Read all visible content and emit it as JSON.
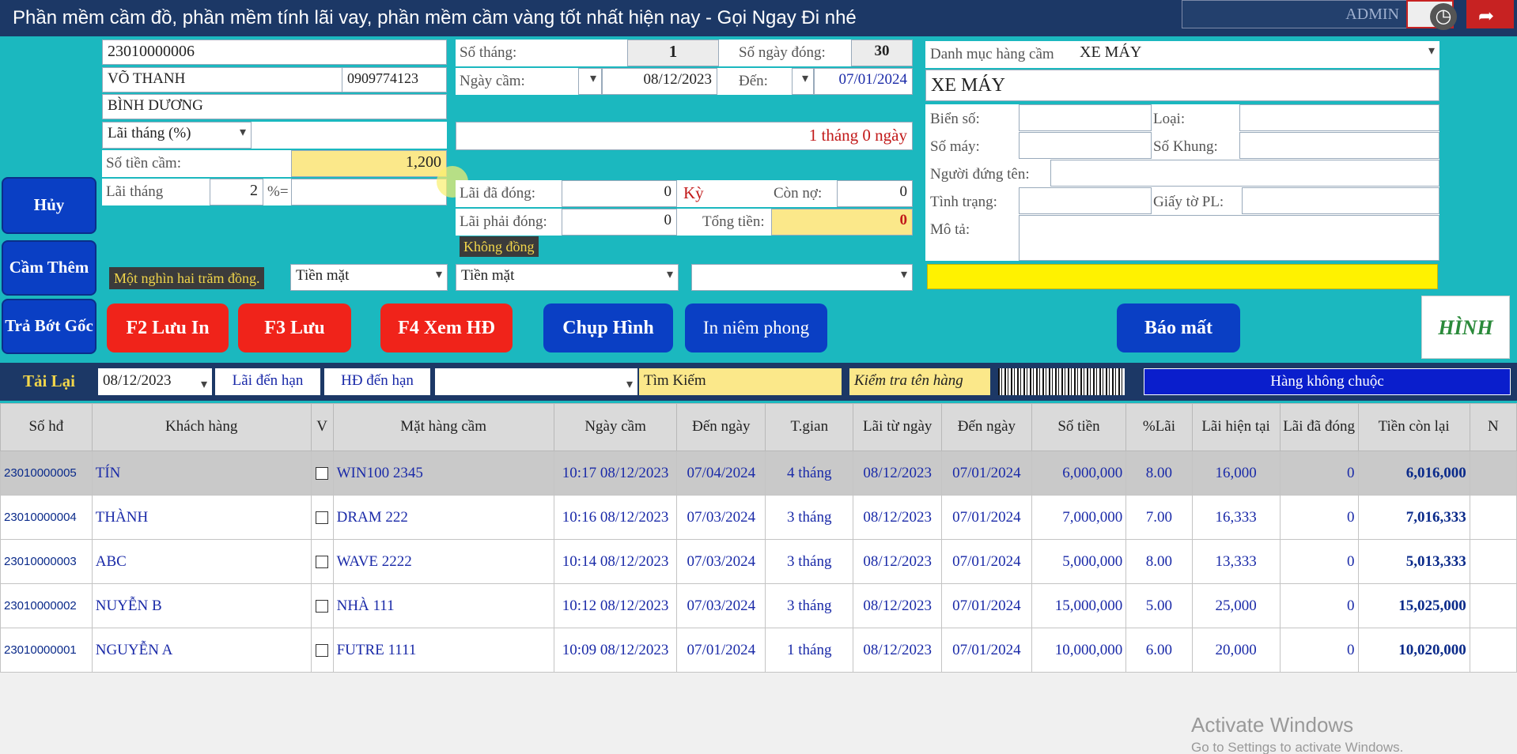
{
  "window": {
    "title": "Phần mềm cầm đồ, phần mềm tính lãi vay, phần mềm cầm vàng tốt nhất hiện nay - Gọi Ngay Đi nhé",
    "user": "ADMIN",
    "clock_icon": "clock-icon",
    "share_icon": "share-icon"
  },
  "customer": {
    "contract_no": "23010000006",
    "name": "VÕ THANH",
    "phone": "0909774123",
    "address": "BÌNH DƯƠNG",
    "interest_type": "Lãi tháng (%)",
    "amount_label": "Số tiền cầm:",
    "amount": "1,200",
    "interest_label": "Lãi tháng",
    "interest_rate": "2",
    "percent_eq": "%=",
    "amount_words": "Một nghìn hai trăm đồng.",
    "payment_method": "Tiền mặt"
  },
  "period": {
    "months_label": "Số tháng:",
    "months": "1",
    "days_paid_label": "Số ngày đóng:",
    "days_paid": "30",
    "pawn_date_label": "Ngày cầm:",
    "pawn_date": "08/12/2023",
    "to_label": "Đến:",
    "to_date": "07/01/2024",
    "duration": "1  tháng  0   ngày",
    "paid_interest_label": "Lãi đã đóng:",
    "paid_interest": "0",
    "period_label": "Kỳ",
    "remaining_label": "Còn nợ:",
    "remaining": "0",
    "due_interest_label": "Lãi phải đóng:",
    "due_interest": "0",
    "total_label": "Tổng tiền:",
    "total": "0",
    "no_money": "Không đồng",
    "payment_method": "Tiền mặt",
    "extra_select": ""
  },
  "item": {
    "category_label": "Danh mục hàng cầm",
    "category": "XE MÁY",
    "name": "XE MÁY",
    "plate_label": "Biển số:",
    "type_label": "Loại:",
    "engine_label": "Số máy:",
    "frame_label": "Số Khung:",
    "owner_label": "Người đứng tên:",
    "condition_label": "Tình trạng:",
    "docs_label": "Giấy tờ PL:",
    "desc_label": "Mô tả:"
  },
  "side_buttons": {
    "cancel": "Hủy",
    "add_pawn": "Cầm Thêm",
    "reduce_principal": "Trả Bớt Gốc"
  },
  "action_buttons": {
    "f2": "F2 Lưu In",
    "f3": "F3 Lưu",
    "f4": "F4 Xem HĐ",
    "photo": "Chụp Hình",
    "seal": "In niêm phong",
    "report_lost": "Báo mất",
    "image_logo": "HÌNH ẢNH"
  },
  "search": {
    "reload": "Tải Lại",
    "date": "08/12/2023",
    "due_interest": "Lãi đến hạn",
    "due_contract": "HĐ đến hạn",
    "filter": "",
    "search": "Tìm Kiếm",
    "check_name": "Kiểm tra tên hàng",
    "status": "Hàng không chuộc"
  },
  "table": {
    "headers": [
      "Số hđ",
      "Khách hàng",
      "V",
      "Mặt hàng cầm",
      "Ngày cầm",
      "Đến ngày",
      "T.gian",
      "Lãi từ ngày",
      "Đến ngày",
      "Số tiền",
      "%Lãi",
      "Lãi hiện tại",
      "Lãi đã đóng",
      "Tiền còn lại",
      "N"
    ],
    "rows": [
      [
        "23010000005",
        "TÍN",
        "",
        "WIN100 2345",
        "10:17 08/12/2023",
        "07/04/2024",
        "4 tháng",
        "08/12/2023",
        "07/01/2024",
        "6,000,000",
        "8.00",
        "16,000",
        "0",
        "6,016,000"
      ],
      [
        "23010000004",
        "THÀNH",
        "",
        "DRAM 222",
        "10:16 08/12/2023",
        "07/03/2024",
        "3 tháng",
        "08/12/2023",
        "07/01/2024",
        "7,000,000",
        "7.00",
        "16,333",
        "0",
        "7,016,333"
      ],
      [
        "23010000003",
        "ABC",
        "",
        "WAVE 2222",
        "10:14 08/12/2023",
        "07/03/2024",
        "3 tháng",
        "08/12/2023",
        "07/01/2024",
        "5,000,000",
        "8.00",
        "13,333",
        "0",
        "5,013,333"
      ],
      [
        "23010000002",
        "NUYỄN B",
        "",
        "NHÀ 111",
        "10:12 08/12/2023",
        "07/03/2024",
        "3 tháng",
        "08/12/2023",
        "07/01/2024",
        "15,000,000",
        "5.00",
        "25,000",
        "0",
        "15,025,000"
      ],
      [
        "23010000001",
        "NGUYỄN A",
        "",
        "FUTRE 1111",
        "10:09 08/12/2023",
        "07/01/2024",
        "1 tháng",
        "08/12/2023",
        "07/01/2024",
        "10,000,000",
        "6.00",
        "20,000",
        "0",
        "10,020,000"
      ]
    ]
  },
  "watermark": {
    "line1": "Activate Windows",
    "line2": "Go to Settings to activate Windows."
  }
}
